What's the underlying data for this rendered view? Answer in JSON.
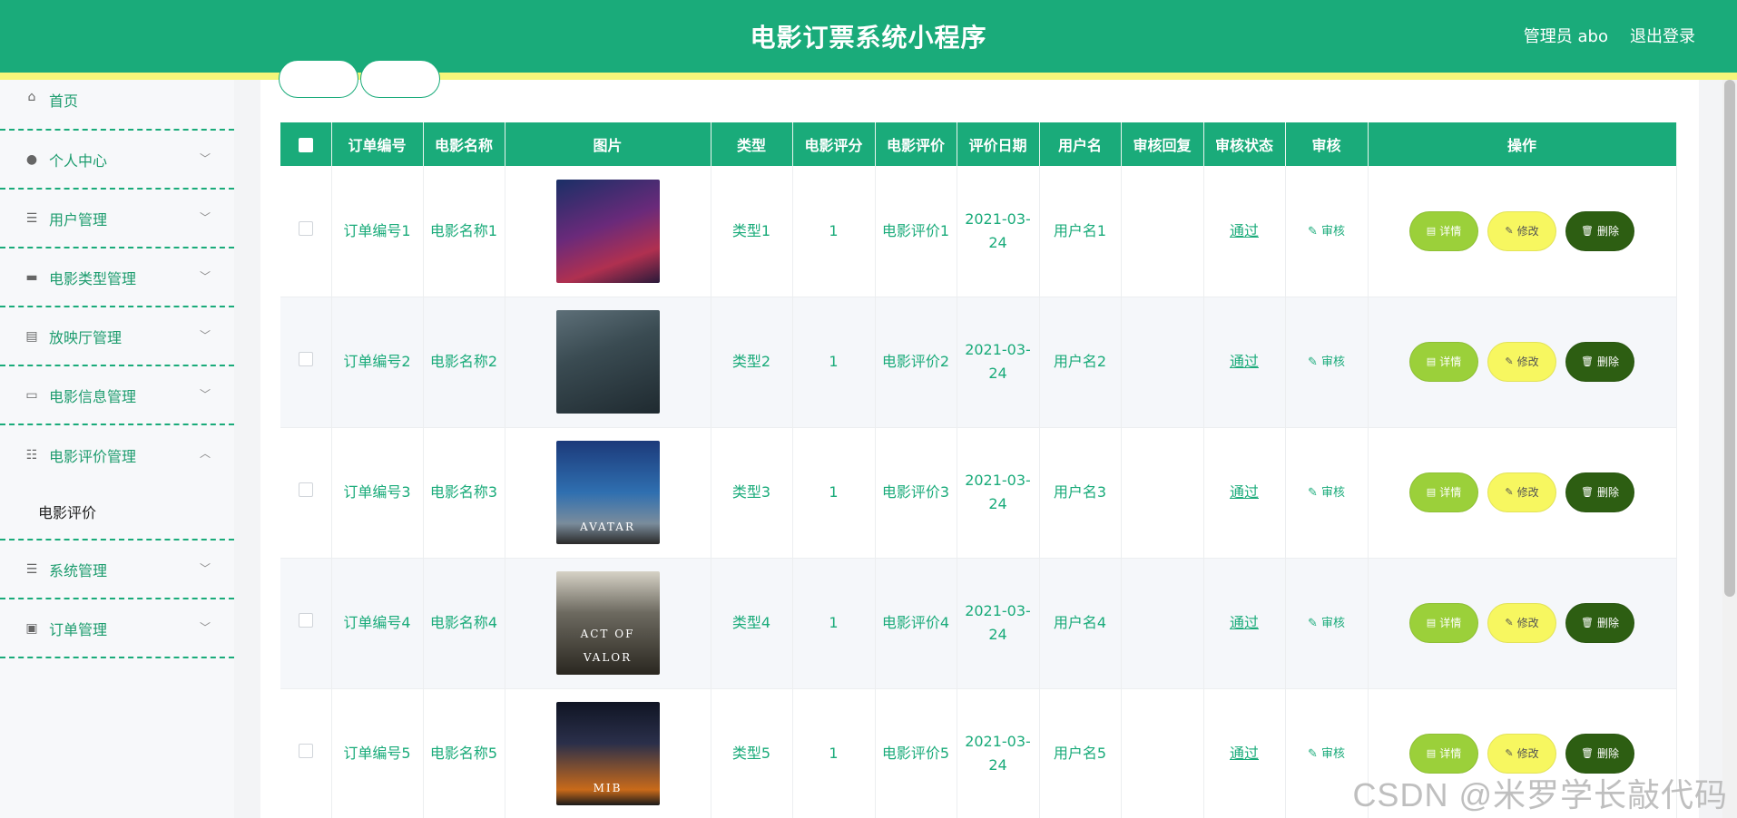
{
  "header": {
    "title": "电影订票系统小程序",
    "admin_label": "管理员 abo",
    "logout_label": "退出登录",
    "bg_color": "#1aab7a",
    "strip_color": "#f6f67a"
  },
  "sidebar": {
    "items": [
      {
        "label": "首页",
        "icon": "home-icon"
      },
      {
        "label": "个人中心",
        "icon": "user-icon"
      },
      {
        "label": "用户管理",
        "icon": "list-icon"
      },
      {
        "label": "电影类型管理",
        "icon": "briefcase-icon"
      },
      {
        "label": "放映厅管理",
        "icon": "clipboard-icon"
      },
      {
        "label": "电影信息管理",
        "icon": "monitor-icon"
      },
      {
        "label": "电影评价管理",
        "icon": "sliders-icon",
        "open": true
      },
      {
        "label": "系统管理",
        "icon": "list-icon"
      },
      {
        "label": "订单管理",
        "icon": "delete-doc-icon"
      }
    ],
    "submenu_active": "电影评价"
  },
  "table": {
    "headers": [
      "订单编号",
      "电影名称",
      "图片",
      "类型",
      "电影评分",
      "电影评价",
      "评价日期",
      "用户名",
      "审核回复",
      "审核状态",
      "审核",
      "操作"
    ],
    "audit_label": "审核",
    "btn_detail": "详情",
    "btn_edit": "修改",
    "btn_delete": "删除",
    "rows": [
      {
        "order_no": "订单编号1",
        "movie_name": "电影名称1",
        "poster": "p1",
        "poster_text": "",
        "type": "类型1",
        "score": "1",
        "review": "电影评价1",
        "date": "2021-03-24",
        "user": "用户名1",
        "reply": "",
        "status": "通过"
      },
      {
        "order_no": "订单编号2",
        "movie_name": "电影名称2",
        "poster": "p2",
        "poster_text": "",
        "type": "类型2",
        "score": "1",
        "review": "电影评价2",
        "date": "2021-03-24",
        "user": "用户名2",
        "reply": "",
        "status": "通过"
      },
      {
        "order_no": "订单编号3",
        "movie_name": "电影名称3",
        "poster": "p3",
        "poster_text": "AVATAR",
        "type": "类型3",
        "score": "1",
        "review": "电影评价3",
        "date": "2021-03-24",
        "user": "用户名3",
        "reply": "",
        "status": "通过"
      },
      {
        "order_no": "订单编号4",
        "movie_name": "电影名称4",
        "poster": "p4",
        "poster_text": "ACT OF VALOR",
        "type": "类型4",
        "score": "1",
        "review": "电影评价4",
        "date": "2021-03-24",
        "user": "用户名4",
        "reply": "",
        "status": "通过"
      },
      {
        "order_no": "订单编号5",
        "movie_name": "电影名称5",
        "poster": "p5",
        "poster_text": "MIB",
        "type": "类型5",
        "score": "1",
        "review": "电影评价5",
        "date": "2021-03-24",
        "user": "用户名5",
        "reply": "",
        "status": "通过"
      }
    ]
  },
  "watermark": "CSDN @米罗学长敲代码"
}
